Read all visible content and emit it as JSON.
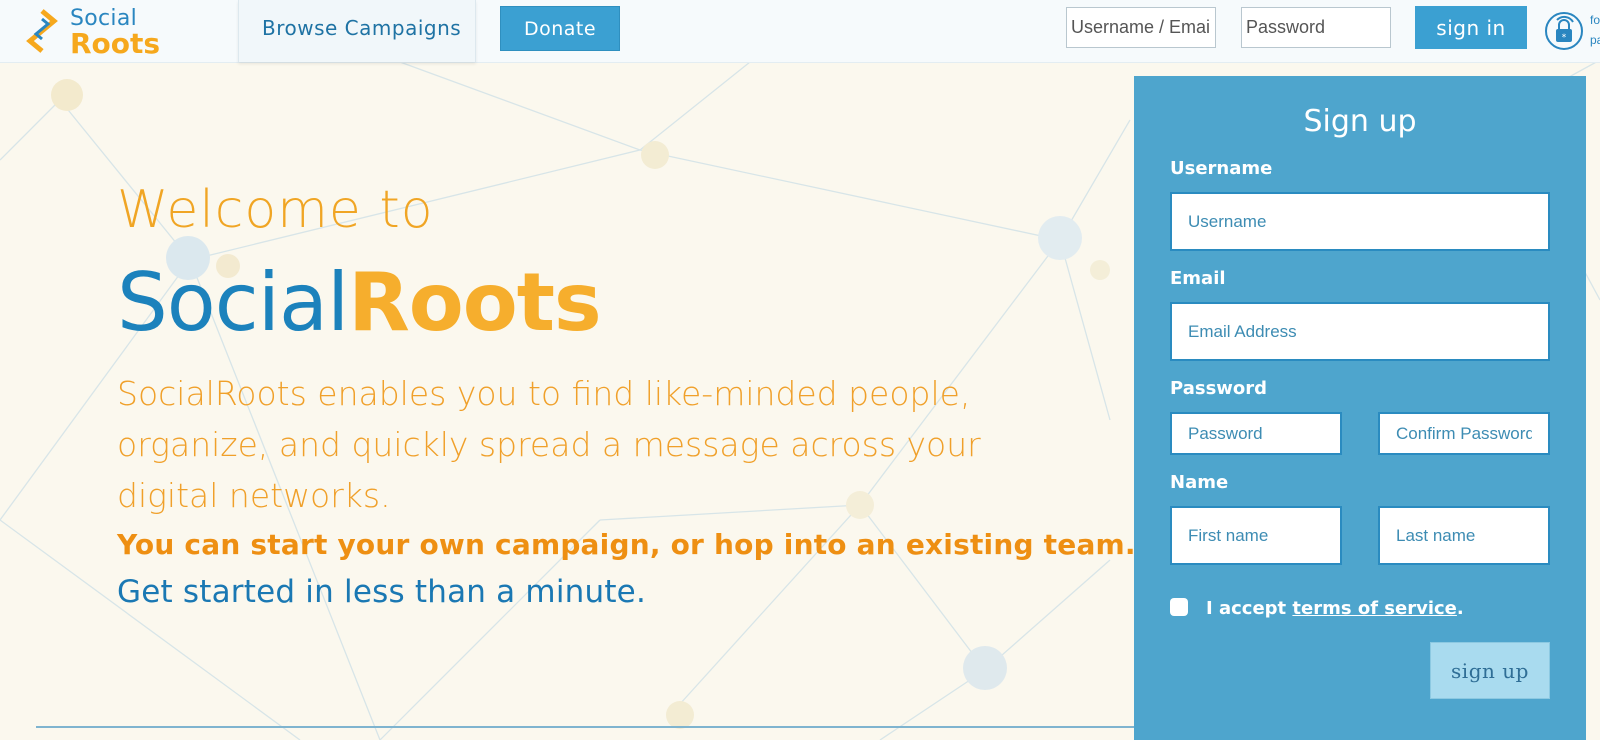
{
  "logo": {
    "social": "Social",
    "roots": "Roots"
  },
  "nav": {
    "browse_campaigns": "Browse Campaigns",
    "donate": "Donate"
  },
  "login": {
    "username_placeholder": "Username / Email",
    "password_placeholder": "Password",
    "sign_in": "sign in",
    "forgot_text": "forgot password"
  },
  "hero": {
    "welcome": "Welcome to",
    "brand_social": "Social",
    "brand_roots": "Roots",
    "description": "SocialRoots enables you to find like-minded people, organize, and quickly spread a message across your digital networks.",
    "cta_campaign": "You can start your own campaign, or hop into an existing team.",
    "cta_started": "Get started in less than a minute."
  },
  "signup": {
    "title": "Sign up",
    "username_label": "Username",
    "username_placeholder": "Username",
    "email_label": "Email",
    "email_placeholder": "Email Address",
    "password_label": "Password",
    "password_placeholder": "Password",
    "confirm_placeholder": "Confirm Password",
    "name_label": "Name",
    "first_placeholder": "First name",
    "last_placeholder": "Last name",
    "terms_prefix": "I accept ",
    "terms_link": "terms of service",
    "terms_suffix": ".",
    "submit": "sign up"
  },
  "colors": {
    "brand_blue": "#1c82bc",
    "brand_orange": "#f6ae2d",
    "panel_blue": "#4ea5cd",
    "button_blue": "#3ba0d2",
    "background": "#fbf8ee"
  }
}
